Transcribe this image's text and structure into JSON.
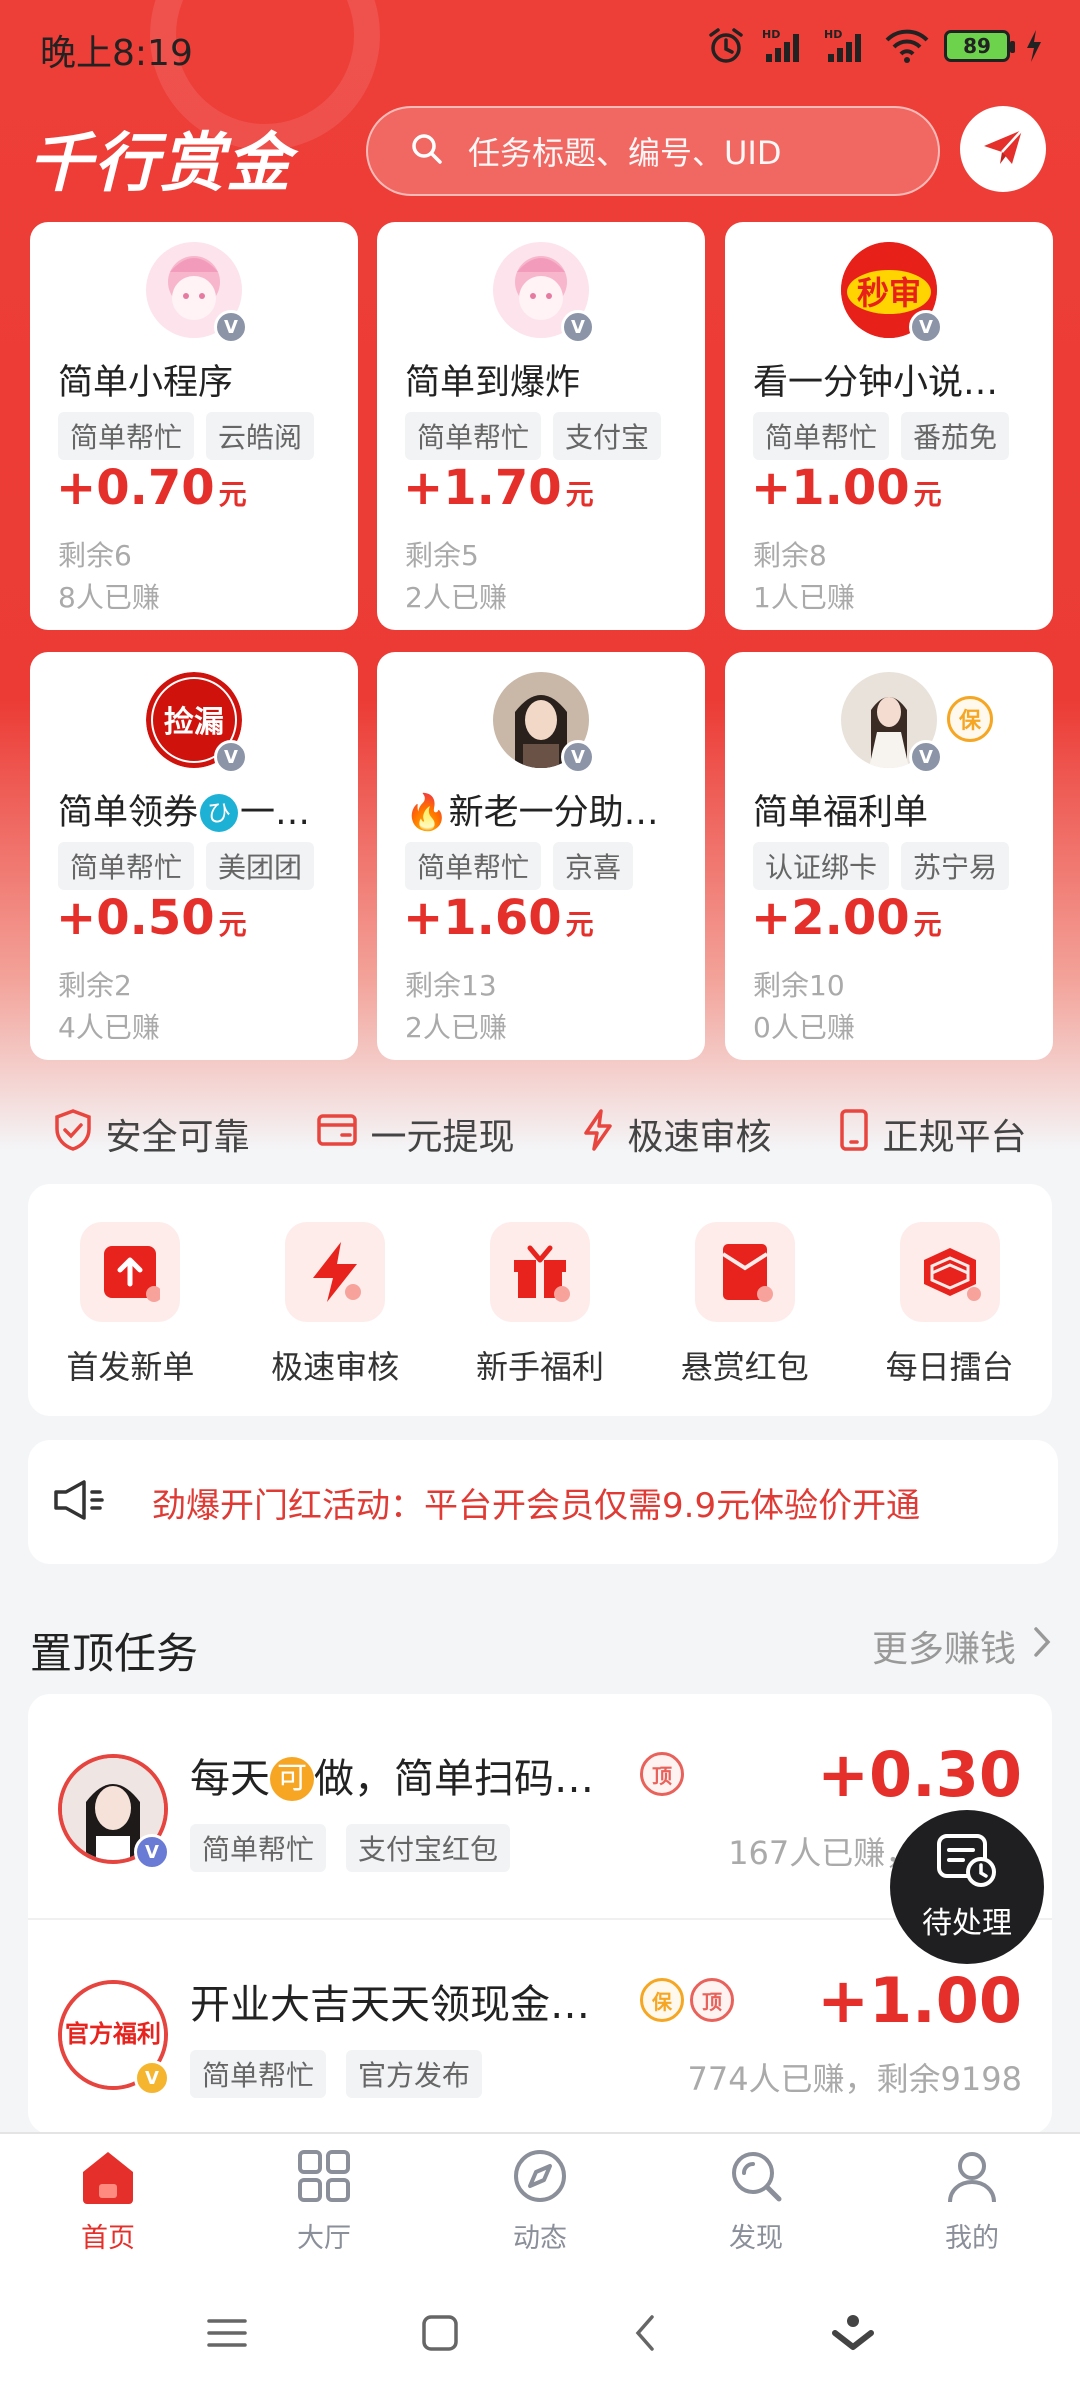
{
  "status_bar": {
    "time": "晚上8:19",
    "battery": "89",
    "signal1": "HD",
    "signal2": "HD"
  },
  "header": {
    "logo": "千行赏金",
    "search_placeholder": "任务标题、编号、UID"
  },
  "task_cards": [
    {
      "title": "简单小程序",
      "tags": [
        "简单帮忙",
        "云皓阅"
      ],
      "price": "+0.70",
      "unit": "元",
      "remain": "剩余6",
      "earned": "8人已赚",
      "avatar": "anime-pink-avatar"
    },
    {
      "title": "简单到爆炸",
      "tags": [
        "简单帮忙",
        "支付宝"
      ],
      "price": "+1.70",
      "unit": "元",
      "remain": "剩余5",
      "earned": "2人已赚",
      "avatar": "anime-pink-avatar"
    },
    {
      "title": "看一分钟小说…",
      "tags": [
        "简单帮忙",
        "番茄免"
      ],
      "price": "+1.00",
      "unit": "元",
      "remain": "剩余8",
      "earned": "1人已赚",
      "avatar": "miaoshen-avatar",
      "avatar_text": "秒审"
    },
    {
      "title": "简单领券",
      "title_emoji": "ひ",
      "title_suffix": "一…",
      "tags": [
        "简单帮忙",
        "美团团"
      ],
      "price": "+0.50",
      "unit": "元",
      "remain": "剩余2",
      "earned": "4人已赚",
      "avatar": "jianlou-avatar",
      "avatar_text": "捡漏"
    },
    {
      "title": "新老一分助…",
      "title_prefix": "🔥",
      "tags": [
        "简单帮忙",
        "京喜"
      ],
      "price": "+1.60",
      "unit": "元",
      "remain": "剩余13",
      "earned": "2人已赚",
      "avatar": "girl-photo-avatar"
    },
    {
      "title": "简单福利单",
      "tags": [
        "认证绑卡",
        "苏宁易"
      ],
      "price": "+2.00",
      "unit": "元",
      "remain": "剩余10",
      "earned": "0人已赚",
      "avatar": "girl-photo-avatar-2",
      "bao": "保"
    }
  ],
  "features": [
    "安全可靠",
    "一元提现",
    "极速审核",
    "正规平台"
  ],
  "quick_menu": [
    "首发新单",
    "极速审核",
    "新手福利",
    "悬赏红包",
    "每日擂台"
  ],
  "announcement": "劲爆开门红活动：平台开会员仅需9.9元体验价开通",
  "pinned": {
    "title": "置顶任务",
    "more": "更多赚钱",
    "items": [
      {
        "title_pre": "每天",
        "title_ke": "可",
        "title_post": "做，简单扫码…",
        "badges": [
          "顶"
        ],
        "tags": [
          "简单帮忙",
          "支付宝红包"
        ],
        "price": "+0.30",
        "stats": "167人已赚，剩余20"
      },
      {
        "title": "开业大吉天天领现金…",
        "badges": [
          "保",
          "顶"
        ],
        "tags": [
          "简单帮忙",
          "官方发布"
        ],
        "price": "+1.00",
        "stats": "774人已赚，剩余9198",
        "avatar_text": "官方福利"
      }
    ]
  },
  "pending": "待处理",
  "tabs": [
    "首页",
    "大厅",
    "动态",
    "发现",
    "我的"
  ],
  "colors": {
    "brand_red": "#e52f2a",
    "hero_red": "#ee3e38",
    "orange": "#f5a623"
  }
}
